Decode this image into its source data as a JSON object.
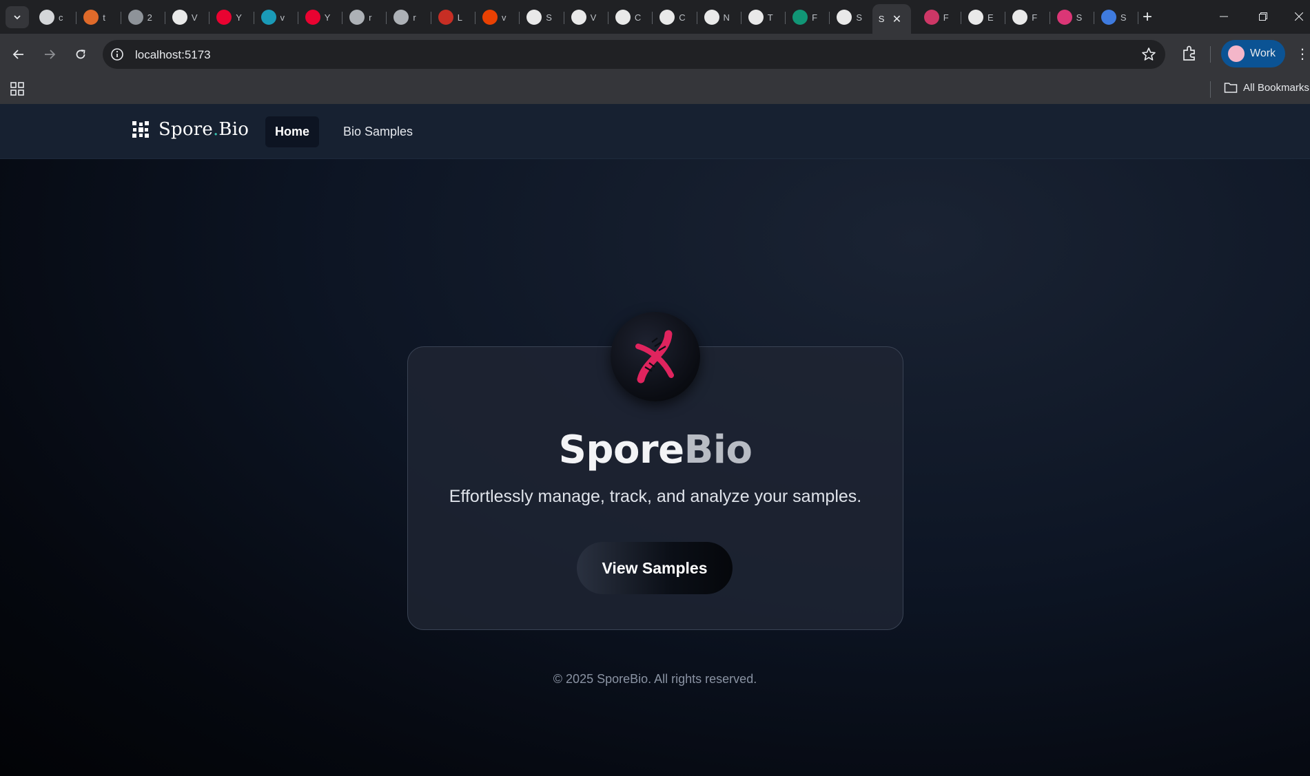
{
  "browser": {
    "tabs": [
      {
        "icon": "chatgpt-icon",
        "title": "c",
        "color": "#e8eaed"
      },
      {
        "icon": "grafana-icon",
        "title": "t",
        "color": "#f4722b"
      },
      {
        "icon": "chart-icon",
        "title": "2",
        "color": "#9aa0a6"
      },
      {
        "icon": "webflow-icon",
        "title": "V",
        "color": "#ffffff"
      },
      {
        "icon": "youtube-icon",
        "title": "Y",
        "color": "#ff0033"
      },
      {
        "icon": "vtools-icon",
        "title": "v",
        "color": "#1aa7c8"
      },
      {
        "icon": "youtube-icon",
        "title": "Y",
        "color": "#ff0033"
      },
      {
        "icon": "gmail-icon",
        "title": "r",
        "color": "#bdc1c6"
      },
      {
        "icon": "globe-icon",
        "title": "r",
        "color": "#bdc1c6"
      },
      {
        "icon": "book-icon",
        "title": "L",
        "color": "#d93025"
      },
      {
        "icon": "reddit-icon",
        "title": "v",
        "color": "#ff4500"
      },
      {
        "icon": "sporebio-icon",
        "title": "S",
        "color": "#ffffff"
      },
      {
        "icon": "framer-icon",
        "title": "V",
        "color": "#ffffff"
      },
      {
        "icon": "framer-icon",
        "title": "C",
        "color": "#ffffff"
      },
      {
        "icon": "ct-icon",
        "title": "C",
        "color": "#ffffff"
      },
      {
        "icon": "rocket-icon",
        "title": "N",
        "color": "#ffffff"
      },
      {
        "icon": "openai-icon",
        "title": "T",
        "color": "#ffffff"
      },
      {
        "icon": "feather-icon",
        "title": "F",
        "color": "#10a37f"
      },
      {
        "icon": "sporebio-icon",
        "title": "S",
        "color": "#ffffff"
      }
    ],
    "active_tab": {
      "title": "S"
    },
    "tabs_after": [
      {
        "icon": "react-icon",
        "title": "F",
        "color": "#e03a6e"
      },
      {
        "icon": "github-icon",
        "title": "E",
        "color": "#ffffff"
      },
      {
        "icon": "notion-icon",
        "title": "F",
        "color": "#ffffff"
      },
      {
        "icon": "pen-icon",
        "title": "S",
        "color": "#f0397f"
      },
      {
        "icon": "google-icon",
        "title": "S",
        "color": "#4285f4"
      }
    ],
    "url": "localhost:5173",
    "profile_label": "Work",
    "all_bookmarks": "All Bookmarks"
  },
  "site": {
    "brand_main": "Spore",
    "brand_dot": ".",
    "brand_tail": "Bio",
    "nav": {
      "home": "Home",
      "samples": "Bio Samples"
    },
    "hero": {
      "title_a": "Spore",
      "title_b": "Bio",
      "tagline": "Effortlessly manage, track, and analyze your samples.",
      "cta": "View Samples"
    },
    "footer": "© 2025 SporeBio. All rights reserved.",
    "accent": "#e0245e",
    "brand_dot_color": "#38c1b0"
  }
}
